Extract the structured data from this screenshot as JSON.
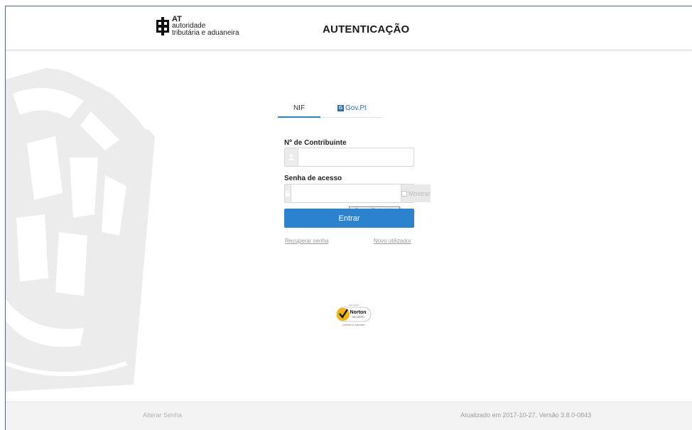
{
  "header": {
    "logo_line1": "AT",
    "logo_line2": "autoridade",
    "logo_line3": "tributária e aduaneira",
    "title": "AUTENTICAÇÃO"
  },
  "tabs": [
    {
      "label": "NIF",
      "active": true
    },
    {
      "label": "Gov.Pt",
      "icon": "gov-pt-icon",
      "badge": "G",
      "active": false
    }
  ],
  "form": {
    "nif_label": "Nº de Contribuinte",
    "nif_value": "",
    "nif_icon": "user-icon",
    "password_label": "Senha de acesso",
    "password_value": "",
    "password_icon": "lock-icon",
    "show_label": "Mostrar",
    "tooltip": "Campo Obrigatório",
    "submit_label": "Entrar"
  },
  "links": {
    "recover_password": "Recuperar senha",
    "new_user": "Novo utilizador"
  },
  "seal": {
    "top": "SECURED",
    "brand": "Norton",
    "sub": "SECURED",
    "powered": "powered by Symantec"
  },
  "footer": {
    "change_password": "Alterar Senha",
    "version_text": "Atualizado em 2017-10-27. Versão 3.8.0-0843"
  },
  "colors": {
    "primary": "#2b82cf",
    "tab_active": "#1e88d6",
    "emblem": "#e6e6e6",
    "norton_yellow": "#f2b705"
  }
}
